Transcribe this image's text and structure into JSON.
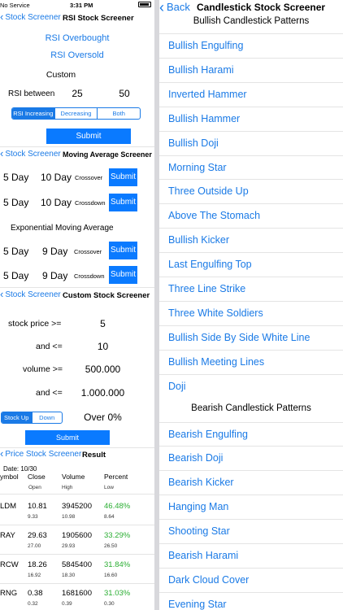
{
  "status": {
    "carrier": "No Service",
    "time": "3:31 PM"
  },
  "rsi": {
    "back": "Stock Screener",
    "title": "RSI Stock Screener",
    "overbought": "RSI Overbought",
    "oversold": "RSI Oversold",
    "custom": "Custom",
    "between_label": "RSI between",
    "low": "25",
    "high": "50",
    "segments": [
      "RSI Increasing",
      "Decreasing",
      "Both"
    ],
    "submit": "Submit"
  },
  "ma": {
    "back": "Stock Screener",
    "title": "Moving Average Screener",
    "rows": [
      {
        "a": "5 Day",
        "b": "10 Day",
        "type": "Crossover",
        "submit": "Submit"
      },
      {
        "a": "5 Day",
        "b": "10 Day",
        "type": "Crossdown",
        "submit": "Submit"
      }
    ],
    "ema_label": "Exponential Moving Average",
    "ema_rows": [
      {
        "a": "5 Day",
        "b": "9 Day",
        "type": "Crossover",
        "submit": "Submit"
      },
      {
        "a": "5 Day",
        "b": "9 Day",
        "type": "Crossdown",
        "submit": "Submit"
      }
    ]
  },
  "custom": {
    "back": "Stock Screener",
    "title": "Custom Stock Screener",
    "price_min_label": "stock price >=",
    "price_min": "5",
    "price_max_label": "and <=",
    "price_max": "10",
    "vol_min_label": "volume >=",
    "vol_min": "500.000",
    "vol_max_label": "and <=",
    "vol_max": "1.000.000",
    "segments": [
      "Stock Up",
      "Down"
    ],
    "over": "Over 0%",
    "submit": "Submit"
  },
  "result": {
    "back": "Price Stock Screener",
    "title": "Result",
    "date": "Date: 10/30",
    "headers": [
      "ymbol",
      "Close",
      "Volume",
      "Percent"
    ],
    "subheaders": [
      "Open",
      "High",
      "Low"
    ],
    "rows": [
      {
        "sym": "LDM",
        "close": "10.81",
        "volume": "3945200",
        "pct": "46.48%",
        "open": "9.33",
        "high": "10.98",
        "low": "8.64"
      },
      {
        "sym": "RAY",
        "close": "29.63",
        "volume": "1905600",
        "pct": "33.29%",
        "open": "27.00",
        "high": "29.93",
        "low": "26.50"
      },
      {
        "sym": "RCW",
        "close": "18.26",
        "volume": "5845400",
        "pct": "31.84%",
        "open": "16.92",
        "high": "18.30",
        "low": "16.60"
      },
      {
        "sym": "RNG",
        "close": "0.38",
        "volume": "1681600",
        "pct": "31.03%",
        "open": "0.32",
        "high": "0.39",
        "low": "0.30"
      }
    ]
  },
  "candle": {
    "back": "Back",
    "title": "Candlestick Stock Screener",
    "bullish_header": "Bullish Candlestick Patterns",
    "bullish": [
      "Bullish Engulfing",
      "Bullish Harami",
      "Inverted Hammer",
      "Bullish Hammer",
      "Bullish Doji",
      "Morning Star",
      "Three Outside Up",
      "Above The Stomach",
      "Bullish Kicker",
      "Last Engulfing Top",
      "Three Line Strike",
      "Three White Soldiers",
      "Bullish Side By Side White Line",
      "Bullish Meeting Lines",
      "Doji"
    ],
    "bearish_header": "Bearish Candlestick Patterns",
    "bearish": [
      "Bearish Engulfing",
      "Bearish Doji",
      "Bearish Kicker",
      "Hanging Man",
      "Shooting Star",
      "Bearish Harami",
      "Dark Cloud Cover",
      "Evening Star"
    ]
  }
}
